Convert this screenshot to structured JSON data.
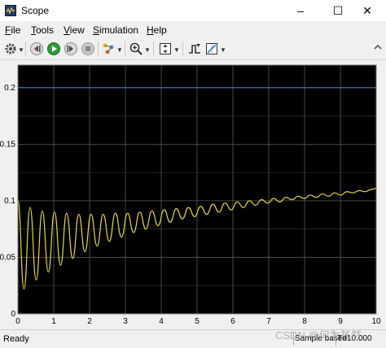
{
  "window": {
    "title": "Scope",
    "minimize_glyph": "–",
    "maximize_glyph": "☐",
    "close_glyph": "✕"
  },
  "menu": [
    {
      "label": "File",
      "mnemonic": "F"
    },
    {
      "label": "Tools",
      "mnemonic": "T"
    },
    {
      "label": "View",
      "mnemonic": "V"
    },
    {
      "label": "Simulation",
      "mnemonic": "S"
    },
    {
      "label": "Help",
      "mnemonic": "H"
    }
  ],
  "toolbar": {
    "icons": [
      "gear-icon",
      "step-back-icon",
      "run-icon",
      "step-forward-icon",
      "stop-icon",
      "highlight-icon",
      "zoom-icon",
      "fit-axes-icon",
      "triggers-icon",
      "cursor-measure-icon"
    ]
  },
  "colors": {
    "plot_bg": "#000000",
    "grid": "#5a5a5a",
    "series_blue": "#2f7bd9",
    "series_yellow": "#e6d63a"
  },
  "chart_data": {
    "type": "line",
    "title": "",
    "xlabel": "",
    "ylabel": "",
    "xlim": [
      0,
      10
    ],
    "ylim": [
      0,
      0.22
    ],
    "xticks": [
      "0",
      "1",
      "2",
      "3",
      "4",
      "5",
      "6",
      "7",
      "8",
      "9",
      "10"
    ],
    "yticks": [
      "0",
      "0.05",
      "0.1",
      "0.15",
      "0.2"
    ],
    "grid": true,
    "series": [
      {
        "color": "#2f7bd9",
        "x": [
          0,
          10
        ],
        "y": [
          0.2,
          0.2
        ]
      },
      {
        "color": "#e6d63a",
        "x": [
          0,
          0.17,
          0.34,
          0.51,
          0.68,
          0.85,
          1.02,
          1.19,
          1.36,
          1.53,
          1.7,
          1.87,
          2.04,
          2.21,
          2.38,
          2.55,
          2.72,
          2.89,
          3.06,
          3.23,
          3.4,
          3.57,
          3.74,
          3.91,
          4.08,
          4.25,
          4.42,
          4.59,
          4.76,
          4.93,
          5.1,
          5.27,
          5.44,
          5.61,
          5.78,
          5.95,
          6.12,
          6.29,
          6.46,
          6.63,
          6.8,
          6.97,
          7.14,
          7.31,
          7.48,
          7.65,
          7.82,
          7.99,
          8.16,
          8.33,
          8.5,
          8.67,
          8.84,
          9.01,
          9.18,
          9.35,
          9.52,
          9.69,
          9.86,
          10
        ],
        "y": [
          0.1,
          0.022,
          0.094,
          0.03,
          0.091,
          0.037,
          0.09,
          0.043,
          0.089,
          0.049,
          0.088,
          0.055,
          0.088,
          0.06,
          0.088,
          0.064,
          0.089,
          0.068,
          0.089,
          0.072,
          0.09,
          0.075,
          0.091,
          0.078,
          0.092,
          0.081,
          0.093,
          0.084,
          0.094,
          0.086,
          0.095,
          0.088,
          0.097,
          0.09,
          0.098,
          0.092,
          0.099,
          0.094,
          0.1,
          0.096,
          0.101,
          0.098,
          0.102,
          0.099,
          0.103,
          0.101,
          0.104,
          0.102,
          0.105,
          0.103,
          0.106,
          0.104,
          0.107,
          0.105,
          0.108,
          0.107,
          0.109,
          0.108,
          0.11,
          0.111
        ]
      }
    ]
  },
  "status": {
    "ready": "Ready",
    "sample": "Sample based",
    "time": "T=10.000"
  },
  "watermark": "CSDN @何为其然"
}
